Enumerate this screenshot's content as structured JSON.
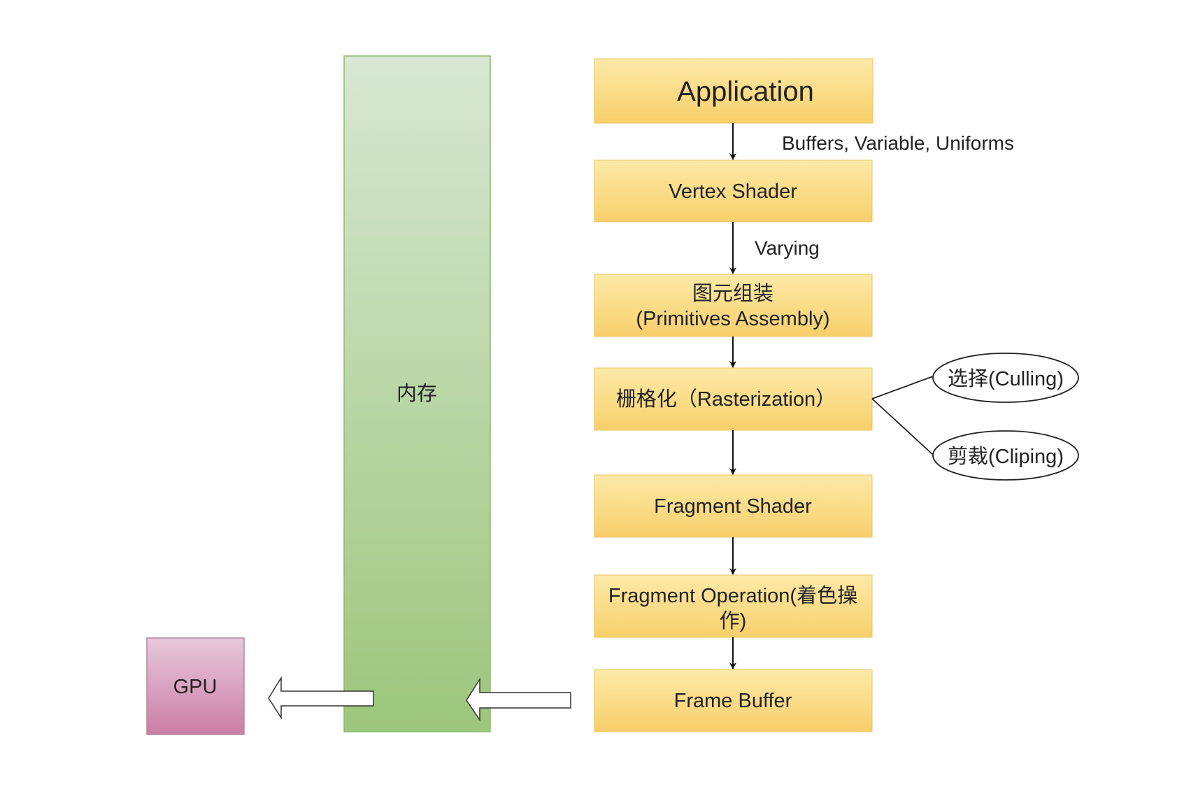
{
  "memory": {
    "label": "内存"
  },
  "gpu": {
    "label": "GPU"
  },
  "stages": {
    "application": "Application",
    "vertex_shader": "Vertex Shader",
    "primitives_line1": "图元组装",
    "primitives_line2": "(Primitives Assembly)",
    "rasterization": "栅格化（Rasterization）",
    "fragment_shader": "Fragment Shader",
    "fragment_operation_line1": "Fragment Operation(着色操",
    "fragment_operation_line2": "作)",
    "frame_buffer": "Frame Buffer"
  },
  "edge_labels": {
    "app_to_vertex": "Buffers, Variable, Uniforms",
    "vertex_to_primitives": "Varying"
  },
  "raster_branches": {
    "culling": "选择(Culling)",
    "clipping": "剪裁(Cliping)"
  },
  "colors": {
    "stage_top": "#fde9a6",
    "stage_bottom": "#f7cf6a",
    "memory_top": "#d6e6d2",
    "memory_bottom": "#9dc67c",
    "gpu_top": "#e4c4d8",
    "gpu_bottom": "#cd7fa4"
  }
}
